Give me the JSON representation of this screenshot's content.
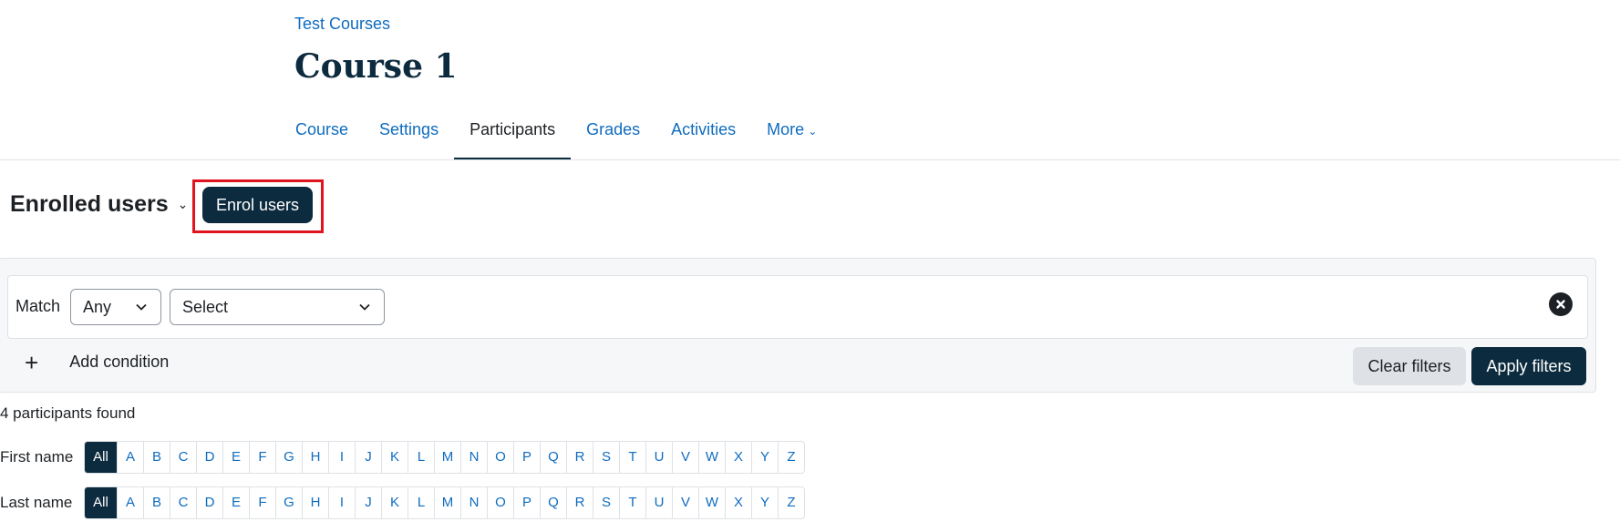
{
  "breadcrumb": "Test Courses",
  "page_title": "Course 1",
  "tabs": [
    {
      "label": "Course"
    },
    {
      "label": "Settings"
    },
    {
      "label": "Participants",
      "active": true
    },
    {
      "label": "Grades"
    },
    {
      "label": "Activities"
    },
    {
      "label": "More"
    }
  ],
  "enrolled": {
    "title": "Enrolled users",
    "enrol_button": "Enrol users"
  },
  "filter": {
    "match_label": "Match",
    "match_value": "Any",
    "condition_value": "Select",
    "add_condition": "Add condition",
    "clear": "Clear filters",
    "apply": "Apply filters"
  },
  "participants_found": "4 participants found",
  "initials": {
    "first_name_label": "First name",
    "last_name_label": "Last name",
    "all_label": "All",
    "letters": [
      "A",
      "B",
      "C",
      "D",
      "E",
      "F",
      "G",
      "H",
      "I",
      "J",
      "K",
      "L",
      "M",
      "N",
      "O",
      "P",
      "Q",
      "R",
      "S",
      "T",
      "U",
      "V",
      "W",
      "X",
      "Y",
      "Z"
    ]
  },
  "colors": {
    "brand_dark": "#0d2b3e",
    "link": "#0f6cbf",
    "highlight": "#e0141e"
  },
  "icons": [
    "chevron-down-icon",
    "close-circle-icon",
    "plus-icon"
  ]
}
